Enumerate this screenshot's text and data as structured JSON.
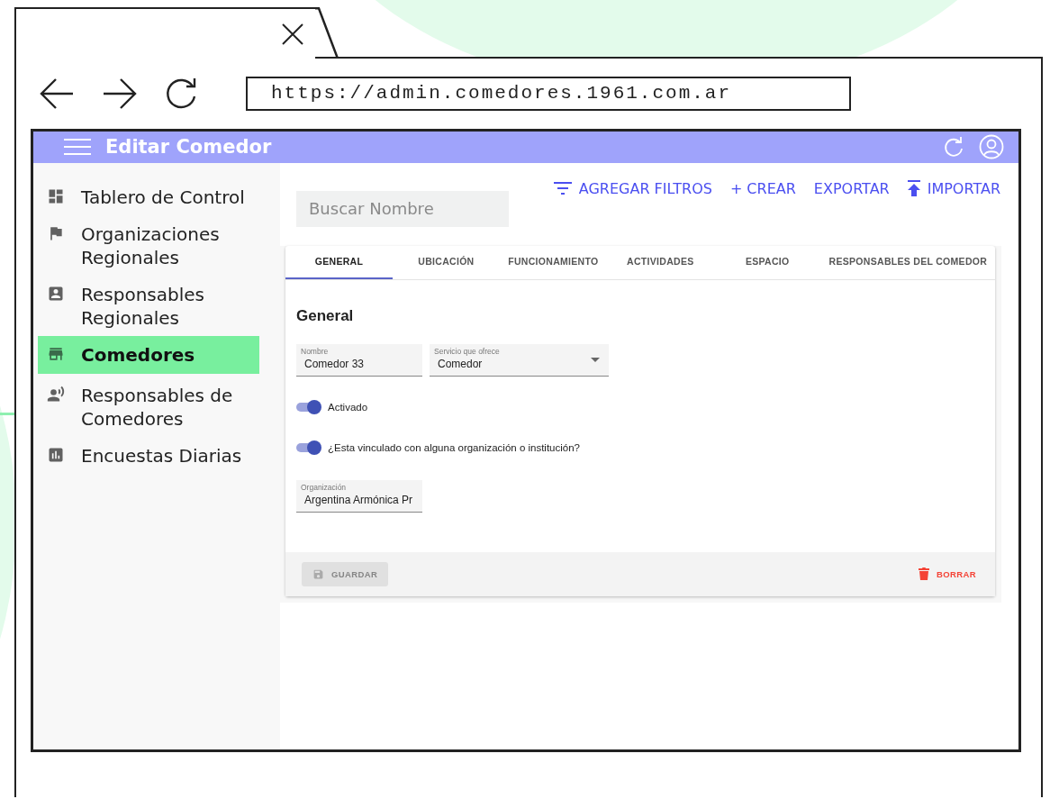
{
  "browser": {
    "url": "https://admin.comedores.1961.com.ar"
  },
  "app_bar": {
    "title": "Editar Comedor"
  },
  "sidebar": {
    "items": [
      {
        "kind": "dashboard",
        "label": "Tablero de Control",
        "selected": false
      },
      {
        "kind": "flag",
        "label": "Organizaciones Regionales",
        "selected": false
      },
      {
        "kind": "person",
        "label": "Responsables Regionales",
        "selected": false
      },
      {
        "kind": "store",
        "label": "Comedores",
        "selected": true
      },
      {
        "kind": "speaker",
        "label": "Responsables de Comedores",
        "selected": false
      },
      {
        "kind": "chart",
        "label": "Encuestas Diarias",
        "selected": false
      }
    ]
  },
  "search": {
    "placeholder": "Buscar Nombre"
  },
  "actions": [
    {
      "kind": "filter",
      "label": "AGREGAR FILTROS"
    },
    {
      "kind": "plain",
      "label": "+ CREAR"
    },
    {
      "kind": "plain",
      "label": "EXPORTAR"
    },
    {
      "kind": "upload",
      "label": "IMPORTAR"
    }
  ],
  "tabs": [
    {
      "label": "GENERAL",
      "selected": true
    },
    {
      "label": "UBICACIÓN",
      "selected": false
    },
    {
      "label": "FUNCIONAMIENTO",
      "selected": false
    },
    {
      "label": "ACTIVIDADES",
      "selected": false
    },
    {
      "label": "ESPACIO",
      "selected": false
    },
    {
      "label": "RESPONSABLES DEL COMEDOR",
      "selected": false
    }
  ],
  "form": {
    "title": "General",
    "fields": [
      {
        "kind": "text",
        "label": "Nombre",
        "value": "Comedor 33"
      },
      {
        "kind": "select",
        "label": "Servicio que ofrece",
        "value": "Comedor"
      }
    ],
    "switches": [
      {
        "label": "Activado",
        "on": true
      },
      {
        "label": "¿Esta vinculado con alguna organización o institución?",
        "on": true
      }
    ],
    "organization": {
      "label": "Organización",
      "value": "Argentina Armónica Pr"
    }
  },
  "footer": {
    "save": {
      "label": "GUARDAR",
      "disabled": true
    },
    "delete": {
      "label": "BORRAR"
    }
  }
}
